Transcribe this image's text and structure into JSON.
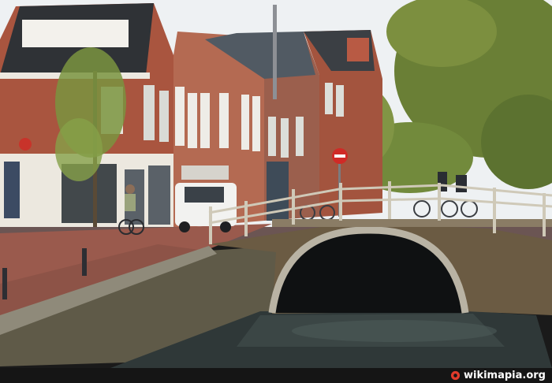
{
  "photo": {
    "subject": "",
    "watermark": "wikimapia.org"
  },
  "colors": {
    "sky": "#eef1f3",
    "brick": "#a4523f",
    "bridge": "#6b5b43",
    "water": "#2f3838",
    "foliage": "#6f8a3a",
    "watermark_icon": "#e03b2b"
  }
}
